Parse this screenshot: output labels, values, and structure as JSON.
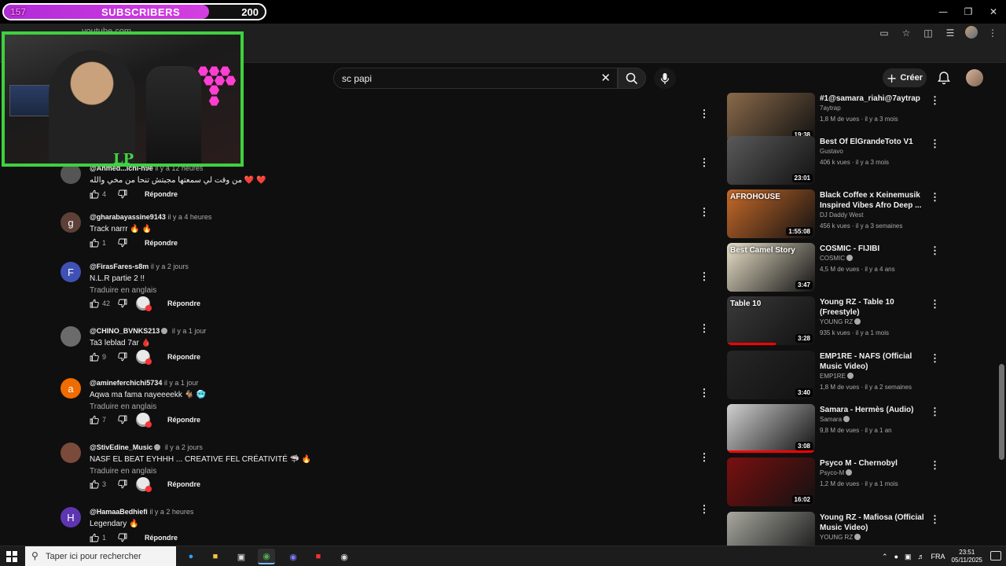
{
  "overlay": {
    "subscribers_current": "157",
    "subscribers_label": "SUBSCRIBERS",
    "subscribers_goal": "200",
    "subscribers_progress": 0.785,
    "webcam_logo": "LP"
  },
  "browser": {
    "url": "youtube.com",
    "window_controls": [
      "minimize",
      "restore",
      "close"
    ]
  },
  "header": {
    "search_value": "sc papi",
    "create_label": "Créer"
  },
  "comments": [
    {
      "avatar_letter": "",
      "avatar_color": "#555555",
      "author": "@Ahmed...ichi-h9e",
      "verified": false,
      "time": "il y a 12 heures",
      "text": "من وقت لي سمعتها مجبتش تنحا من مخي والله ❤️ ❤️",
      "translate": "",
      "likes": "4",
      "creator_heart": false,
      "reply": "Répondre"
    },
    {
      "avatar_letter": "g",
      "avatar_color": "#5d4037",
      "author": "@gharabayassine9143",
      "verified": false,
      "time": "il y a 4 heures",
      "text": "Track narrr 🔥 🔥",
      "translate": "",
      "likes": "1",
      "creator_heart": false,
      "reply": "Répondre"
    },
    {
      "avatar_letter": "F",
      "avatar_color": "#3f51b5",
      "author": "@FirasFares-s8m",
      "verified": false,
      "time": "il y a 2 jours",
      "text": "N.L.R partie 2 !!",
      "translate": "Traduire en anglais",
      "likes": "42",
      "creator_heart": true,
      "reply": "Répondre"
    },
    {
      "avatar_letter": "",
      "avatar_color": "#6b6b6b",
      "author": "@CHINO_BVNKS213",
      "verified": true,
      "time": "il y a 1 jour",
      "text": "Ta3 leblad 7ar 🩸",
      "translate": "",
      "likes": "9",
      "creator_heart": true,
      "reply": "Répondre"
    },
    {
      "avatar_letter": "a",
      "avatar_color": "#ef6c00",
      "author": "@amineferchichi5734",
      "verified": false,
      "time": "il y a 1 jour",
      "text": "Aqwa ma fama nayeeeekk 🐐 🥶",
      "translate": "Traduire en anglais",
      "likes": "7",
      "creator_heart": true,
      "reply": "Répondre"
    },
    {
      "avatar_letter": "",
      "avatar_color": "#7a4a3a",
      "author": "@StivEdine_Music",
      "verified": true,
      "time": "il y a 2 jours",
      "text": "NASF EL BEAT EYHHH ... CREATIVE FEL CRÉATIVITÉ 🦈 🔥",
      "translate": "Traduire en anglais",
      "likes": "3",
      "creator_heart": true,
      "reply": "Répondre"
    },
    {
      "avatar_letter": "H",
      "avatar_color": "#5e35b1",
      "author": "@HamaaBedhiefi",
      "verified": false,
      "time": "il y a 2 heures",
      "text": "Legendary 🔥",
      "translate": "",
      "likes": "1",
      "creator_heart": false,
      "reply": "Répondre"
    }
  ],
  "related": [
    {
      "title": "#1@samara_riahi@7aytrap",
      "channel": "7aytrap",
      "verified": false,
      "meta": "1,8 M de vues · il y a 3 mois",
      "duration": "19:38",
      "thumb_color": "#8a6a4a",
      "watched": 0
    },
    {
      "title": "Best Of ElGrandeToto V1",
      "channel": "Gustavo",
      "verified": false,
      "meta": "406 k vues · il y a 3 mois",
      "duration": "23:01",
      "thumb_color": "#5a5a5a",
      "watched": 0
    },
    {
      "title": "Black Coffee x Keinemusik Inspired Vibes  Afro Deep ...",
      "channel": "DJ Daddy West",
      "verified": false,
      "meta": "456 k vues · il y a 3 semaines",
      "duration": "1:55:08",
      "thumb_color": "#c86a2a",
      "watched": 0,
      "thumb_text": "AFROHOUSE"
    },
    {
      "title": "COSMIC - FIJIBI",
      "channel": "COSMIC",
      "verified": true,
      "meta": "4,5 M de vues · il y a 4 ans",
      "duration": "3:47",
      "thumb_color": "#e8e0c8",
      "watched": 0,
      "thumb_text": "Best Camel Story"
    },
    {
      "title": "Young RZ - Table 10 (Freestyle)",
      "channel": "YOUNG RZ",
      "verified": true,
      "meta": "935 k vues · il y a 1 mois",
      "duration": "3:28",
      "thumb_color": "#3a3a3a",
      "watched": 0.55,
      "thumb_text": "Table 10"
    },
    {
      "title": "EMP1RE - NAFS (Official Music Video)",
      "channel": "EMP1RE",
      "verified": true,
      "meta": "1,8 M de vues · il y a 2 semaines",
      "duration": "3:40",
      "thumb_color": "#262626",
      "watched": 0
    },
    {
      "title": "Samara - Hermès (Audio)",
      "channel": "Samara",
      "verified": true,
      "meta": "9,8 M de vues · il y a 1 an",
      "duration": "3:08",
      "thumb_color": "#d0d0d0",
      "watched": 1
    },
    {
      "title": "Psyco M -  Chernobyl",
      "channel": "Psyco-M",
      "verified": true,
      "meta": "1,2 M de vues · il y a 1 mois",
      "duration": "16:02",
      "thumb_color": "#7a1010",
      "watched": 0
    },
    {
      "title": "Young RZ - Mafiosa (Official Music Video)",
      "channel": "YOUNG RZ",
      "verified": true,
      "meta": "",
      "duration": "",
      "thumb_color": "#a8a8a0",
      "watched": 0
    }
  ],
  "taskbar": {
    "search_placeholder": "Taper ici pour rechercher",
    "language": "FRA",
    "time": "23:51",
    "date": "05/11/2025"
  }
}
